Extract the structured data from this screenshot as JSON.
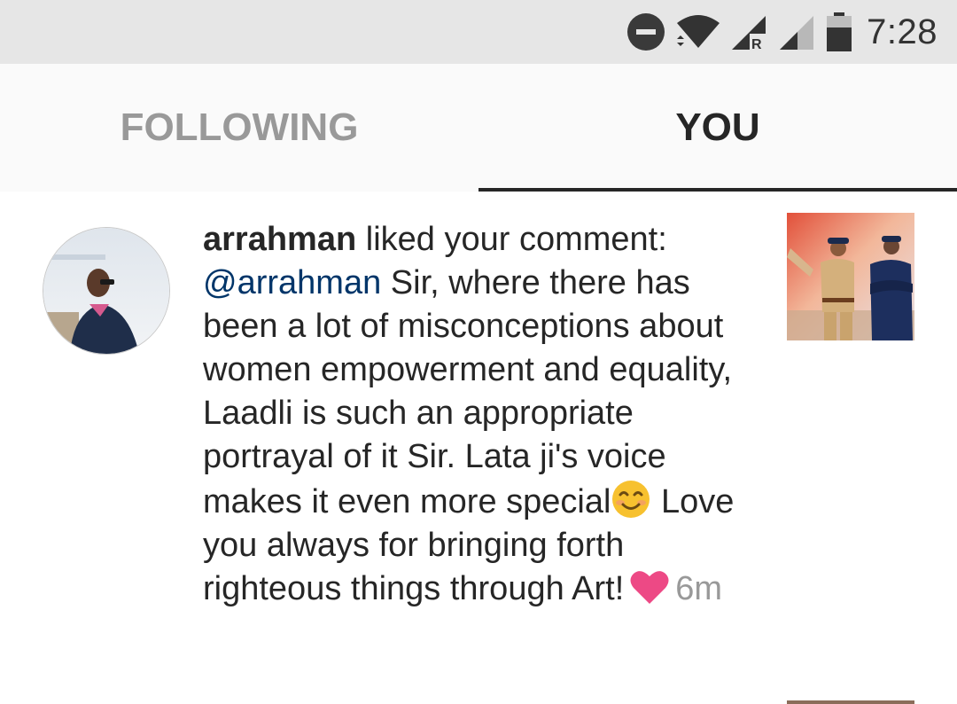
{
  "status_bar": {
    "time": "7:28",
    "icons": [
      "do-not-disturb-icon",
      "wifi-icon",
      "signal-roaming-icon",
      "signal-icon",
      "battery-icon"
    ],
    "roaming_label": "R"
  },
  "tabs": [
    {
      "label": "FOLLOWING",
      "selected": false
    },
    {
      "label": "YOU",
      "selected": true
    }
  ],
  "notification": {
    "username": "arrahman",
    "action": " liked your comment: ",
    "mention": "@arrahman",
    "comment_part1": " Sir, where there has been a lot of misconceptions about women empowerment and equality, Laadli is such an appropriate portrayal of it Sir. Lata ji's voice makes it even more special",
    "emoji": "smiling-face-emoji",
    "comment_part2": " Love you always for bringing forth righteous things through Art!",
    "heart": "heart-icon",
    "time_ago": "6m"
  },
  "colors": {
    "status_bar_bg": "#e6e6e6",
    "tab_bar_bg": "#fafafa",
    "selected_tab": "#262626",
    "unselected_tab": "#999999",
    "mention": "#003569",
    "heart": "#ed4985",
    "timestamp": "#999999"
  }
}
